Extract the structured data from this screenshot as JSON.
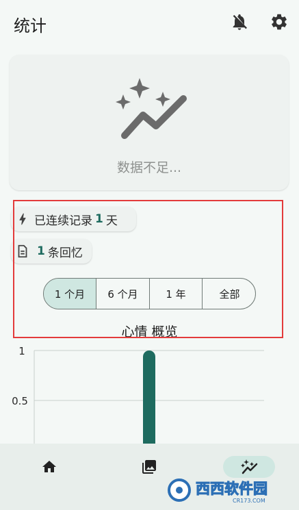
{
  "header": {
    "title": "统计",
    "icons": [
      "notifications-off-icon",
      "settings-icon"
    ]
  },
  "insight_card": {
    "empty_text": "数据不足..."
  },
  "chips": {
    "streak": {
      "prefix": "已连续记录",
      "count": "1",
      "suffix": "天"
    },
    "memories": {
      "count": "1",
      "suffix": "条回忆"
    }
  },
  "range_selector": {
    "options": [
      "1 个月",
      "6 个月",
      "1 年",
      "全部"
    ],
    "selected": "1 个月"
  },
  "mood_overview": {
    "title": "心情 概览"
  },
  "chart_data": {
    "type": "bar",
    "categories": [
      ""
    ],
    "values": [
      1
    ],
    "title": "",
    "xlabel": "",
    "ylabel": "",
    "ylim": [
      0,
      1
    ],
    "yticks": [
      "1",
      "0.5"
    ],
    "bar_color": "#1e6b5f"
  },
  "bottom_nav": {
    "items": [
      "home-icon",
      "gallery-icon",
      "stats-icon"
    ],
    "active": "stats-icon"
  },
  "watermark": {
    "text": "西西软件园",
    "sub": "CR173.COM"
  },
  "colors": {
    "accent": "#1e6b5f",
    "selected_bg": "#cfe7e1",
    "highlight": "#e33b3b"
  }
}
